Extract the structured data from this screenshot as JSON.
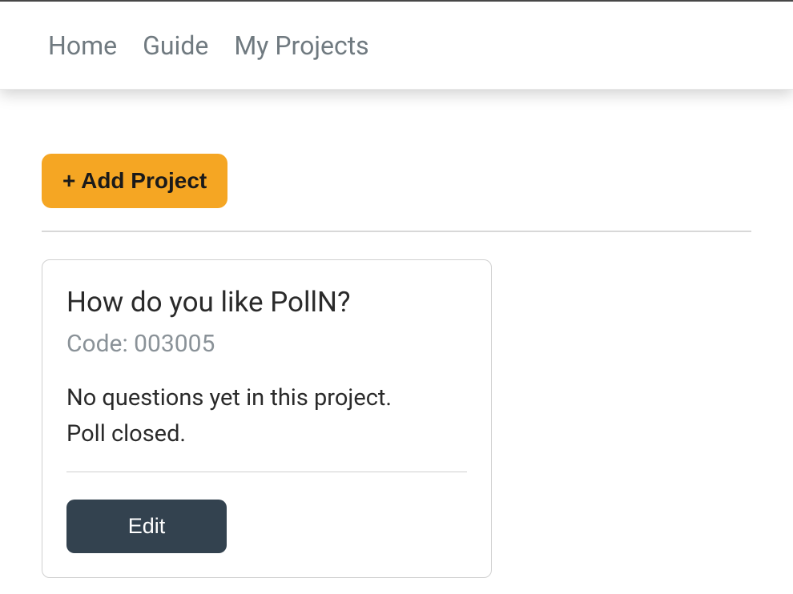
{
  "nav": {
    "home": "Home",
    "guide": "Guide",
    "my_projects": "My Projects"
  },
  "actions": {
    "add_project": "+ Add Project"
  },
  "project": {
    "title": "How do you like PollN?",
    "code_label": "Code: 003005",
    "status_line1": "No questions yet in this project.",
    "status_line2": "Poll closed.",
    "edit_label": "Edit"
  }
}
